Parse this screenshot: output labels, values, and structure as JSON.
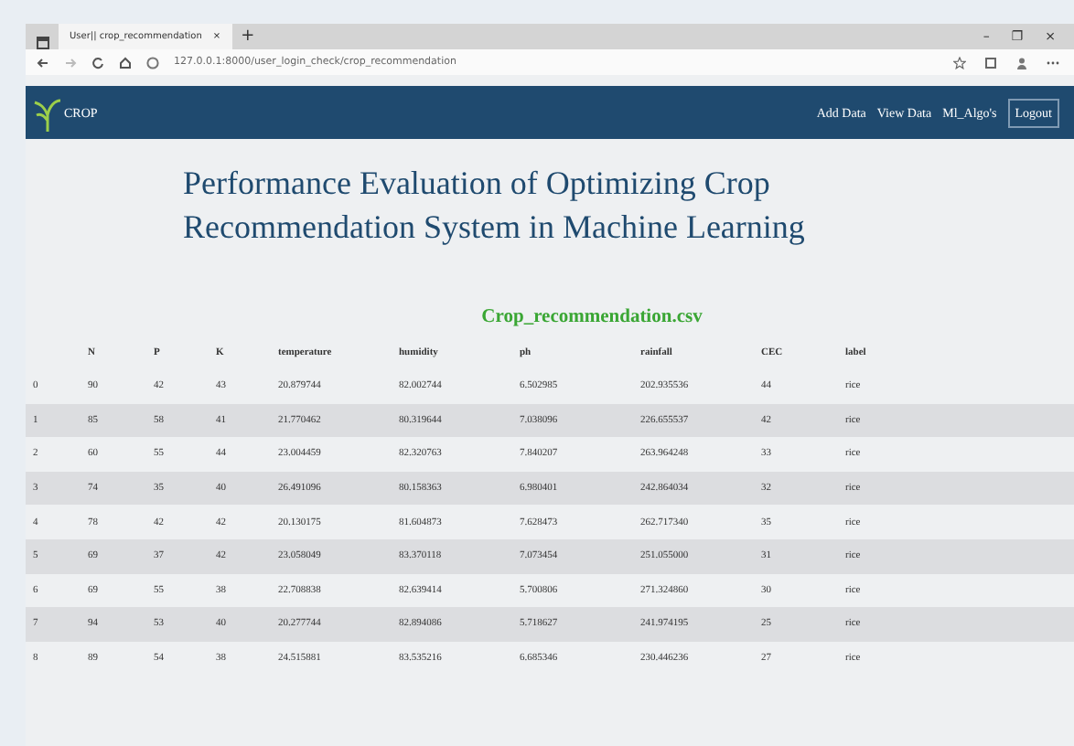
{
  "browser": {
    "tab_title": "User|| crop_recommendation",
    "tab_close": "×",
    "new_tab": "+",
    "url": "127.0.0.1:8000/user_login_check/crop_recommendation",
    "window_controls": [
      "–",
      "❐",
      "×"
    ]
  },
  "navbar": {
    "brand": "CROP",
    "links": [
      {
        "label": "Add Data",
        "kind": "link"
      },
      {
        "label": "View Data",
        "kind": "link"
      },
      {
        "label": "Ml_Algo's",
        "kind": "link"
      },
      {
        "label": "Logout",
        "kind": "button"
      }
    ]
  },
  "heading": "Performance Evaluation of Optimizing Crop Recommendation System in Machine Learning",
  "file_title": "Crop_recommendation.csv",
  "table": {
    "columns": [
      "",
      "N",
      "P",
      "K",
      "temperature",
      "humidity",
      "ph",
      "rainfall",
      "CEC",
      "label"
    ],
    "rows": [
      [
        "0",
        "90",
        "42",
        "43",
        "20.879744",
        "82.002744",
        "6.502985",
        "202.935536",
        "44",
        "rice"
      ],
      [
        "1",
        "85",
        "58",
        "41",
        "21.770462",
        "80.319644",
        "7.038096",
        "226.655537",
        "42",
        "rice"
      ],
      [
        "2",
        "60",
        "55",
        "44",
        "23.004459",
        "82.320763",
        "7.840207",
        "263.964248",
        "33",
        "rice"
      ],
      [
        "3",
        "74",
        "35",
        "40",
        "26.491096",
        "80.158363",
        "6.980401",
        "242.864034",
        "32",
        "rice"
      ],
      [
        "4",
        "78",
        "42",
        "42",
        "20.130175",
        "81.604873",
        "7.628473",
        "262.717340",
        "35",
        "rice"
      ],
      [
        "5",
        "69",
        "37",
        "42",
        "23.058049",
        "83.370118",
        "7.073454",
        "251.055000",
        "31",
        "rice"
      ],
      [
        "6",
        "69",
        "55",
        "38",
        "22.708838",
        "82.639414",
        "5.700806",
        "271.324860",
        "30",
        "rice"
      ],
      [
        "7",
        "94",
        "53",
        "40",
        "20.277744",
        "82.894086",
        "5.718627",
        "241.974195",
        "25",
        "rice"
      ],
      [
        "8",
        "89",
        "54",
        "38",
        "24.515881",
        "83.535216",
        "6.685346",
        "230.446236",
        "27",
        "rice"
      ]
    ]
  }
}
